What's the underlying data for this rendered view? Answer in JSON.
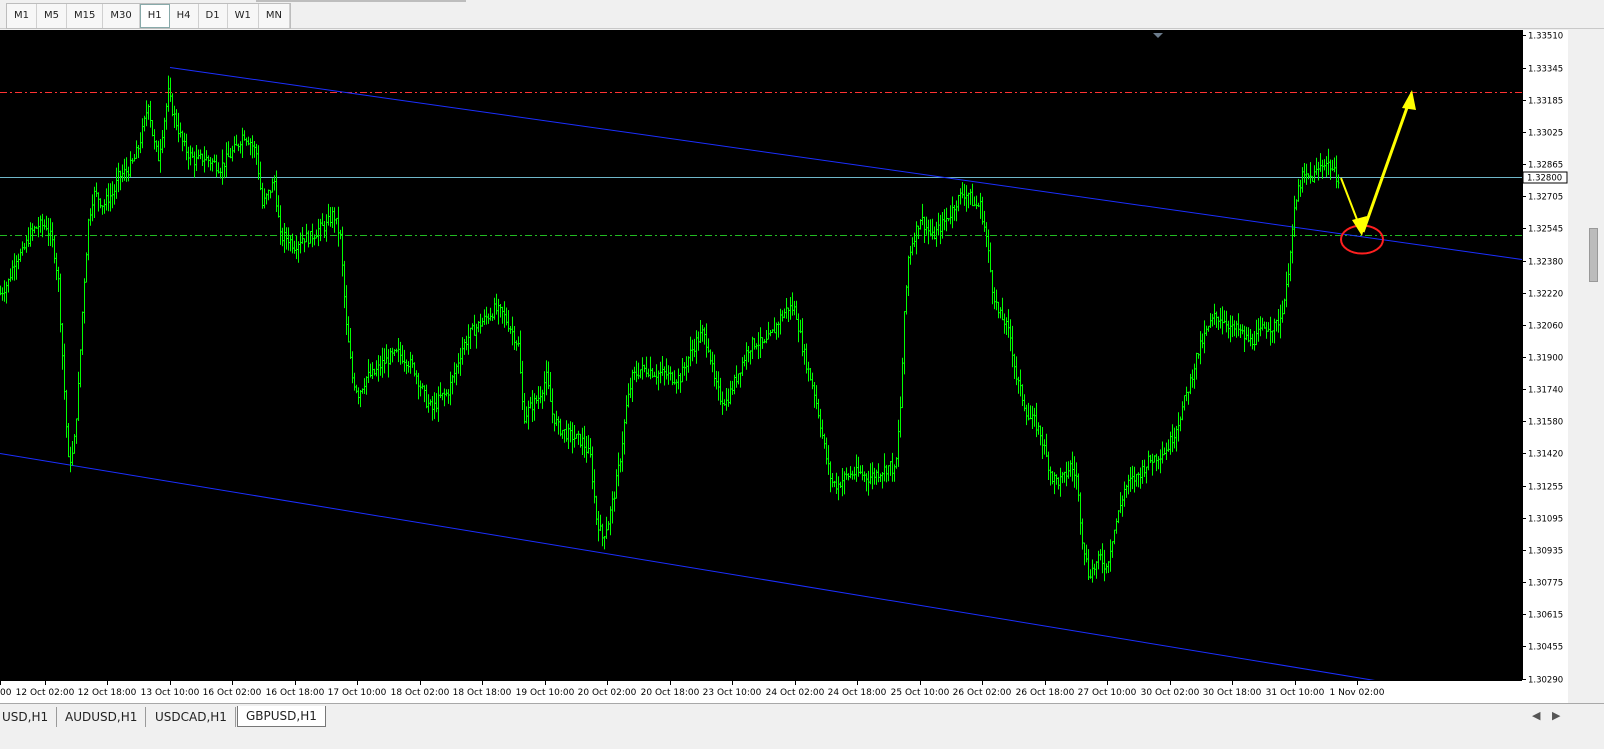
{
  "toolbar": {
    "timeframes": [
      "M1",
      "M5",
      "M15",
      "M30",
      "H1",
      "H4",
      "D1",
      "W1",
      "MN"
    ],
    "active": "H1"
  },
  "tabs": [
    {
      "label": "USD,H1",
      "active": false
    },
    {
      "label": "AUDUSD,H1",
      "active": false
    },
    {
      "label": "USDCAD,H1",
      "active": false
    },
    {
      "label": "GBPUSD,H1",
      "active": true
    }
  ],
  "chart_data": {
    "type": "bar",
    "symbol_tab": "GBPUSD,H1",
    "background": "#000000",
    "price_color": "#00ff00",
    "ylim": [
      1.3029,
      1.3351
    ],
    "y_ticks": [
      "1.33510",
      "1.33345",
      "1.33185",
      "1.33025",
      "1.32865",
      "1.32705",
      "1.32545",
      "1.32380",
      "1.32220",
      "1.32060",
      "1.31900",
      "1.31740",
      "1.31580",
      "1.31420",
      "1.31255",
      "1.31095",
      "1.30935",
      "1.30775",
      "1.30615",
      "1.30455",
      "1.30290"
    ],
    "x_ticks": [
      "00",
      "12 Oct 02:00",
      "12 Oct 18:00",
      "13 Oct 10:00",
      "16 Oct 02:00",
      "16 Oct 18:00",
      "17 Oct 10:00",
      "18 Oct 02:00",
      "18 Oct 18:00",
      "19 Oct 10:00",
      "20 Oct 02:00",
      "20 Oct 18:00",
      "23 Oct 10:00",
      "24 Oct 02:00",
      "24 Oct 18:00",
      "25 Oct 10:00",
      "26 Oct 02:00",
      "26 Oct 18:00",
      "27 Oct 10:00",
      "30 Oct 02:00",
      "30 Oct 18:00",
      "31 Oct 10:00",
      "1 Nov 02:00"
    ],
    "current_price": "1.32800",
    "price_path": [
      [
        0,
        1.3222
      ],
      [
        8,
        1.3228
      ],
      [
        15,
        1.324
      ],
      [
        22,
        1.3242
      ],
      [
        30,
        1.3252
      ],
      [
        38,
        1.3256
      ],
      [
        46,
        1.3256
      ],
      [
        53,
        1.3246
      ],
      [
        58,
        1.3228
      ],
      [
        63,
        1.3182
      ],
      [
        68,
        1.3138
      ],
      [
        73,
        1.3142
      ],
      [
        78,
        1.3175
      ],
      [
        83,
        1.3222
      ],
      [
        88,
        1.3258
      ],
      [
        93,
        1.3272
      ],
      [
        98,
        1.327
      ],
      [
        103,
        1.3266
      ],
      [
        108,
        1.327
      ],
      [
        113,
        1.3272
      ],
      [
        118,
        1.328
      ],
      [
        123,
        1.3282
      ],
      [
        128,
        1.3284
      ],
      [
        133,
        1.3288
      ],
      [
        138,
        1.3295
      ],
      [
        143,
        1.3305
      ],
      [
        148,
        1.3318
      ],
      [
        153,
        1.3298
      ],
      [
        158,
        1.329
      ],
      [
        163,
        1.3306
      ],
      [
        168,
        1.3322
      ],
      [
        173,
        1.3312
      ],
      [
        178,
        1.3304
      ],
      [
        183,
        1.3296
      ],
      [
        188,
        1.3292
      ],
      [
        195,
        1.3288
      ],
      [
        203,
        1.329
      ],
      [
        211,
        1.3288
      ],
      [
        220,
        1.3285
      ],
      [
        228,
        1.329
      ],
      [
        236,
        1.3295
      ],
      [
        243,
        1.3302
      ],
      [
        250,
        1.3298
      ],
      [
        256,
        1.3292
      ],
      [
        262,
        1.3266
      ],
      [
        268,
        1.3272
      ],
      [
        274,
        1.3278
      ],
      [
        280,
        1.325
      ],
      [
        287,
        1.325
      ],
      [
        294,
        1.3246
      ],
      [
        302,
        1.325
      ],
      [
        310,
        1.325
      ],
      [
        318,
        1.3254
      ],
      [
        326,
        1.3256
      ],
      [
        333,
        1.3262
      ],
      [
        340,
        1.325
      ],
      [
        346,
        1.3205
      ],
      [
        352,
        1.318
      ],
      [
        358,
        1.3172
      ],
      [
        366,
        1.318
      ],
      [
        374,
        1.3182
      ],
      [
        382,
        1.3187
      ],
      [
        390,
        1.319
      ],
      [
        398,
        1.3192
      ],
      [
        406,
        1.3189
      ],
      [
        414,
        1.3184
      ],
      [
        420,
        1.3176
      ],
      [
        426,
        1.3168
      ],
      [
        432,
        1.3164
      ],
      [
        440,
        1.317
      ],
      [
        447,
        1.3172
      ],
      [
        454,
        1.3182
      ],
      [
        462,
        1.3195
      ],
      [
        470,
        1.3202
      ],
      [
        478,
        1.3206
      ],
      [
        486,
        1.321
      ],
      [
        494,
        1.3214
      ],
      [
        502,
        1.3212
      ],
      [
        510,
        1.3205
      ],
      [
        518,
        1.3196
      ],
      [
        523,
        1.316
      ],
      [
        530,
        1.3165
      ],
      [
        538,
        1.317
      ],
      [
        546,
        1.318
      ],
      [
        552,
        1.3162
      ],
      [
        558,
        1.3155
      ],
      [
        566,
        1.3152
      ],
      [
        574,
        1.315
      ],
      [
        582,
        1.3148
      ],
      [
        590,
        1.314
      ],
      [
        596,
        1.311
      ],
      [
        602,
        1.31
      ],
      [
        608,
        1.3108
      ],
      [
        614,
        1.3122
      ],
      [
        620,
        1.314
      ],
      [
        626,
        1.3165
      ],
      [
        632,
        1.318
      ],
      [
        640,
        1.3184
      ],
      [
        648,
        1.3184
      ],
      [
        656,
        1.3182
      ],
      [
        664,
        1.3182
      ],
      [
        672,
        1.318
      ],
      [
        680,
        1.318
      ],
      [
        688,
        1.319
      ],
      [
        696,
        1.3198
      ],
      [
        702,
        1.3202
      ],
      [
        708,
        1.3196
      ],
      [
        714,
        1.3178
      ],
      [
        720,
        1.317
      ],
      [
        726,
        1.3168
      ],
      [
        732,
        1.3175
      ],
      [
        740,
        1.3185
      ],
      [
        748,
        1.3195
      ],
      [
        756,
        1.3198
      ],
      [
        764,
        1.3196
      ],
      [
        772,
        1.3202
      ],
      [
        780,
        1.321
      ],
      [
        788,
        1.3215
      ],
      [
        795,
        1.3214
      ],
      [
        801,
        1.3198
      ],
      [
        807,
        1.3185
      ],
      [
        813,
        1.3175
      ],
      [
        819,
        1.316
      ],
      [
        825,
        1.3142
      ],
      [
        831,
        1.3128
      ],
      [
        837,
        1.3126
      ],
      [
        844,
        1.313
      ],
      [
        852,
        1.3132
      ],
      [
        860,
        1.3132
      ],
      [
        868,
        1.313
      ],
      [
        876,
        1.3132
      ],
      [
        884,
        1.3134
      ],
      [
        890,
        1.3136
      ],
      [
        895,
        1.3132
      ],
      [
        900,
        1.3165
      ],
      [
        904,
        1.321
      ],
      [
        908,
        1.324
      ],
      [
        912,
        1.3248
      ],
      [
        916,
        1.3254
      ],
      [
        920,
        1.326
      ],
      [
        926,
        1.3255
      ],
      [
        932,
        1.325
      ],
      [
        938,
        1.3254
      ],
      [
        944,
        1.3258
      ],
      [
        950,
        1.3262
      ],
      [
        956,
        1.3268
      ],
      [
        962,
        1.3272
      ],
      [
        968,
        1.3272
      ],
      [
        974,
        1.3266
      ],
      [
        980,
        1.3266
      ],
      [
        986,
        1.325
      ],
      [
        992,
        1.3225
      ],
      [
        998,
        1.3212
      ],
      [
        1004,
        1.3208
      ],
      [
        1010,
        1.32
      ],
      [
        1016,
        1.318
      ],
      [
        1022,
        1.317
      ],
      [
        1028,
        1.316
      ],
      [
        1034,
        1.3158
      ],
      [
        1040,
        1.3152
      ],
      [
        1046,
        1.314
      ],
      [
        1052,
        1.313
      ],
      [
        1058,
        1.3128
      ],
      [
        1064,
        1.313
      ],
      [
        1070,
        1.3136
      ],
      [
        1076,
        1.313
      ],
      [
        1082,
        1.31
      ],
      [
        1088,
        1.3082
      ],
      [
        1094,
        1.3085
      ],
      [
        1100,
        1.309
      ],
      [
        1106,
        1.3085
      ],
      [
        1112,
        1.31
      ],
      [
        1118,
        1.3112
      ],
      [
        1124,
        1.3124
      ],
      [
        1130,
        1.3128
      ],
      [
        1136,
        1.313
      ],
      [
        1142,
        1.3134
      ],
      [
        1148,
        1.3138
      ],
      [
        1154,
        1.314
      ],
      [
        1160,
        1.3142
      ],
      [
        1166,
        1.3144
      ],
      [
        1172,
        1.315
      ],
      [
        1178,
        1.3158
      ],
      [
        1184,
        1.3168
      ],
      [
        1190,
        1.3178
      ],
      [
        1196,
        1.319
      ],
      [
        1202,
        1.3198
      ],
      [
        1208,
        1.3205
      ],
      [
        1214,
        1.321
      ],
      [
        1220,
        1.321
      ],
      [
        1226,
        1.3208
      ],
      [
        1232,
        1.3204
      ],
      [
        1238,
        1.3204
      ],
      [
        1244,
        1.32
      ],
      [
        1250,
        1.3198
      ],
      [
        1256,
        1.32
      ],
      [
        1262,
        1.3204
      ],
      [
        1268,
        1.3206
      ],
      [
        1274,
        1.3205
      ],
      [
        1280,
        1.321
      ],
      [
        1286,
        1.3224
      ],
      [
        1290,
        1.3245
      ],
      [
        1294,
        1.3262
      ],
      [
        1298,
        1.3274
      ],
      [
        1302,
        1.328
      ],
      [
        1306,
        1.328
      ],
      [
        1312,
        1.328
      ],
      [
        1318,
        1.3284
      ],
      [
        1324,
        1.3288
      ],
      [
        1330,
        1.3286
      ],
      [
        1334,
        1.3282
      ],
      [
        1338,
        1.328
      ]
    ],
    "trendlines": [
      {
        "name": "upper-channel",
        "color": "#1b2fff",
        "p1": [
          "13 Oct 10:00",
          1.3335
        ],
        "p2": [
          "1 Nov 02:00",
          1.3239
        ]
      },
      {
        "name": "lower-channel",
        "color": "#1b2fff",
        "p1": [
          "11 Oct",
          1.3142
        ],
        "p2": [
          "1 Nov 02:00",
          1.303
        ]
      }
    ],
    "hlines": [
      {
        "name": "resistance",
        "price": 1.33225,
        "color": "#ff3333",
        "style": "dashdot"
      },
      {
        "name": "current",
        "price": 1.328,
        "color": "#6fb6c9",
        "style": "solid"
      },
      {
        "name": "support",
        "price": 1.3251,
        "color": "#22bb22",
        "style": "dashdot"
      }
    ],
    "annotations": {
      "arrow_color": "#ffff00",
      "circle_color": "#ff2020",
      "circle_price": 1.325
    }
  }
}
